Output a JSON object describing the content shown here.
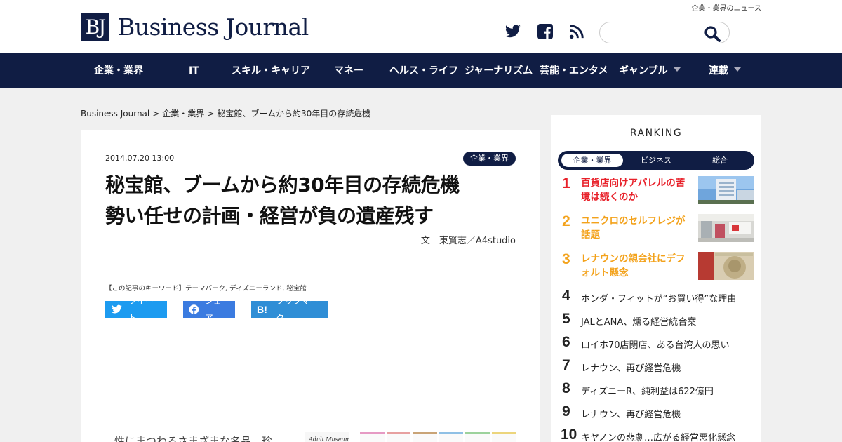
{
  "header": {
    "logo_mark": "BJ",
    "logo_text": "Business Journal",
    "tagline": "企業・業界のニュース",
    "search_placeholder": ""
  },
  "nav": {
    "items": [
      {
        "label": "企業・業界"
      },
      {
        "label": "IT"
      },
      {
        "label": "スキル・キャリア"
      },
      {
        "label": "マネー"
      },
      {
        "label": "ヘルス・ライフ"
      },
      {
        "label": "ジャーナリズム"
      },
      {
        "label": "芸能・エンタメ"
      },
      {
        "label": "ギャンブル"
      },
      {
        "label": "連載"
      }
    ]
  },
  "breadcrumb": {
    "home": "Business Journal",
    "sep": ">",
    "category": "企業・業界",
    "current": "秘宝館、ブームから約30年目の存続危機"
  },
  "article": {
    "date": "2014.07.20 13:00",
    "category": "企業・業界",
    "title_line1": "秘宝館、ブームから約30年目の存続危機",
    "title_line2": "勢い任せの計画・経営が負の遺産残す",
    "author": "文＝東賢志／A4studio",
    "keywords": "【この記事のキーワード】テーマパーク, ディズニーランド, 秘宝館",
    "share_twitter": "ツイート",
    "share_facebook": "シェア",
    "share_hatena": "ブックマーク",
    "body_start": "性にまつわるさまざまな名品、珍"
  },
  "ranking": {
    "title": "RANKING",
    "tabs": [
      "企業・業界",
      "ビジネス",
      "総合"
    ],
    "items": [
      {
        "rank": "1",
        "text_line1": "百貨店向けアパレルの苦",
        "text_line2": "境は続くのか"
      },
      {
        "rank": "2",
        "text_line1": "ユニクロのセルフレジが",
        "text_line2": "話題"
      },
      {
        "rank": "3",
        "text_line1": "レナウンの親会社にデフ",
        "text_line2": "ォルト懸念"
      },
      {
        "rank": "4",
        "text": "ホンダ・フィットが“お買い得”な理由"
      },
      {
        "rank": "5",
        "text": "JALとANA、燻る経営統合案"
      },
      {
        "rank": "6",
        "text": "ロイホ70店閉店、ある台湾人の思い"
      },
      {
        "rank": "7",
        "text": "レナウン、再び経営危機"
      },
      {
        "rank": "8",
        "text": "ディズニーR、純利益は622億円"
      },
      {
        "rank": "9",
        "text": "レナウン、再び経営危機"
      },
      {
        "rank": "10",
        "text": "キヤノンの悲劇…広がる経営悪化懸念"
      }
    ]
  },
  "colors": {
    "navy": "#101d44",
    "rank_red": "#e8212a",
    "rank_orange": "#f3a21b",
    "twitter": "#1d9bf0",
    "facebook": "#3b7be0",
    "hatena": "#2f8ed6"
  }
}
